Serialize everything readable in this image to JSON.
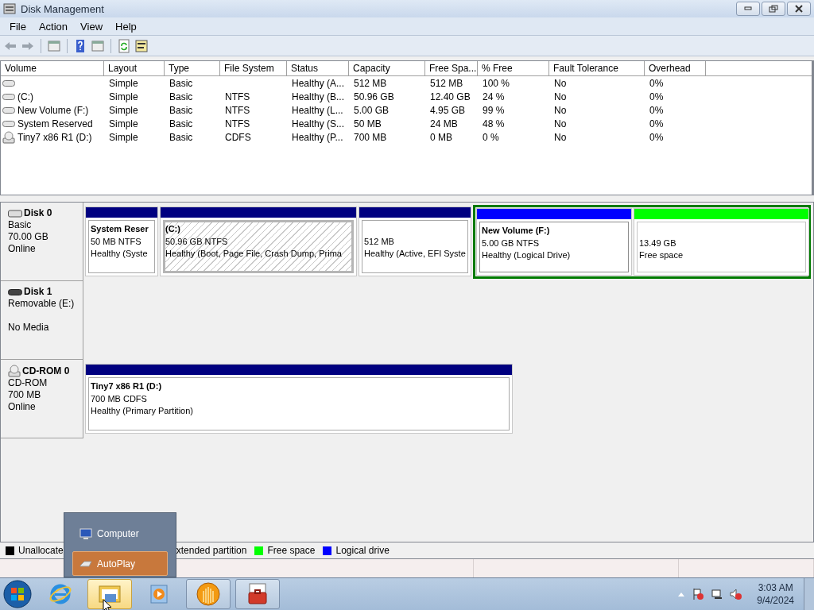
{
  "window": {
    "title": "Disk Management"
  },
  "menu": [
    {
      "label": "File"
    },
    {
      "label": "Action"
    },
    {
      "label": "View"
    },
    {
      "label": "Help"
    }
  ],
  "volume_table": {
    "columns": [
      "Volume",
      "Layout",
      "Type",
      "File System",
      "Status",
      "Capacity",
      "Free Spa...",
      "% Free",
      "Fault Tolerance",
      "Overhead"
    ],
    "rows": [
      {
        "kind": "disk",
        "cells": [
          "",
          "Simple",
          "Basic",
          "",
          "Healthy (A...",
          "512 MB",
          "512 MB",
          "100 %",
          "No",
          "0%"
        ]
      },
      {
        "kind": "disk",
        "cells": [
          "(C:)",
          "Simple",
          "Basic",
          "NTFS",
          "Healthy (B...",
          "50.96 GB",
          "12.40 GB",
          "24 %",
          "No",
          "0%"
        ]
      },
      {
        "kind": "disk",
        "cells": [
          "New Volume (F:)",
          "Simple",
          "Basic",
          "NTFS",
          "Healthy (L...",
          "5.00 GB",
          "4.95 GB",
          "99 %",
          "No",
          "0%"
        ]
      },
      {
        "kind": "disk",
        "cells": [
          "System Reserved",
          "Simple",
          "Basic",
          "NTFS",
          "Healthy (S...",
          "50 MB",
          "24 MB",
          "48 %",
          "No",
          "0%"
        ]
      },
      {
        "kind": "cdrom",
        "cells": [
          "Tiny7 x86 R1 (D:)",
          "Simple",
          "Basic",
          "CDFS",
          "Healthy (P...",
          "700 MB",
          "0 MB",
          "0 %",
          "No",
          "0%"
        ]
      }
    ]
  },
  "disks": [
    {
      "kind": "disk",
      "name": "Disk 0",
      "details": [
        "Basic",
        "70.00 GB"
      ],
      "status": "Online",
      "partitions": [
        {
          "kind": "primary",
          "color": "#000080",
          "title": "System Reser",
          "size": "50 MB NTFS",
          "status": "Healthy (Syste",
          "selected": false
        },
        {
          "kind": "primary",
          "color": "#000080",
          "title": "(C:)",
          "size": "50.96 GB NTFS",
          "status": "Healthy (Boot, Page File, Crash Dump, Prima",
          "selected": true
        },
        {
          "kind": "primary",
          "color": "#000080",
          "size": "512 MB",
          "status": "Healthy (Active, EFI Syste",
          "selected": false
        },
        {
          "kind": "extended",
          "children": [
            {
              "kind": "logical",
              "color": "#0000ff",
              "title": "New Volume  (F:)",
              "size": "5.00 GB NTFS",
              "status": "Healthy (Logical Drive)",
              "selected": false
            },
            {
              "kind": "free",
              "color": "#00ff00",
              "size": "13.49 GB",
              "status": "Free space",
              "selected": false
            }
          ]
        }
      ]
    },
    {
      "kind": "removable",
      "name": "Disk 1",
      "details": [
        "Removable (E:)"
      ],
      "status": "No Media"
    },
    {
      "kind": "cdrom",
      "name": "CD-ROM 0",
      "details": [
        "CD-ROM",
        "700 MB"
      ],
      "status": "Online",
      "partitions": [
        {
          "kind": "primary",
          "color": "#000080",
          "title": "Tiny7 x86 R1  (D:)",
          "size": "700 MB CDFS",
          "status": "Healthy (Primary Partition)",
          "selected": false
        }
      ]
    }
  ],
  "legend": [
    {
      "label": "Unallocate",
      "color": "#000000"
    },
    {
      "label": "xtended partition"
    },
    {
      "label": "Free space",
      "color": "#00ff00"
    },
    {
      "label": "Logical drive",
      "color": "#0000ff"
    }
  ],
  "jump_list": [
    {
      "kind": "computer",
      "label": "Computer",
      "selected": false
    },
    {
      "kind": "autoplay",
      "label": "AutoPlay",
      "selected": true
    }
  ],
  "taskbar": [
    {
      "kind": "ie",
      "running": false,
      "selected": false
    },
    {
      "kind": "explorer",
      "running": true,
      "selected": true
    },
    {
      "kind": "media",
      "running": false,
      "selected": false
    },
    {
      "kind": "globe",
      "running": true,
      "selected": false
    },
    {
      "kind": "toolbox",
      "running": true,
      "selected": false
    }
  ],
  "clock": {
    "time": "3:03 AM",
    "date": "9/4/2024"
  }
}
